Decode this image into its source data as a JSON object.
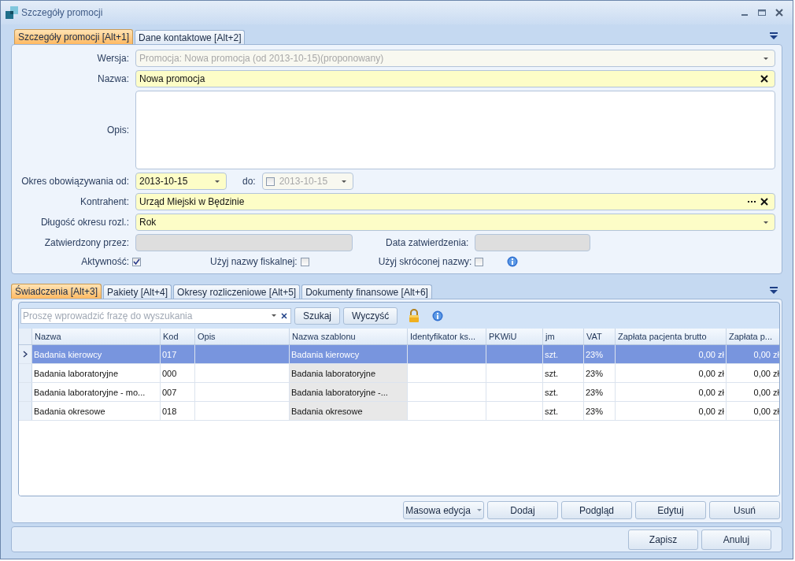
{
  "window": {
    "title": "Szczegóły promocji"
  },
  "top_tabs": [
    {
      "label": "Szczegóły promocji [Alt+1]",
      "selected": true
    },
    {
      "label": "Dane kontaktowe [Alt+2]",
      "selected": false
    }
  ],
  "form": {
    "version": {
      "label": "Wersja:",
      "value": "Promocja: Nowa promocja (od 2013-10-15)(proponowany)",
      "disabled": true
    },
    "name": {
      "label": "Nazwa:",
      "value": "Nowa promocja"
    },
    "description": {
      "label": "Opis:"
    },
    "period_from": {
      "label": "Okres obowiązywania od:",
      "value": "2013-10-15"
    },
    "period_to": {
      "label": "do:",
      "value": "2013-10-15",
      "checked": false,
      "disabled": true
    },
    "contractor": {
      "label": "Kontrahent:",
      "value": "Urząd Miejski w Będzinie"
    },
    "settlement_length": {
      "label": "Długość okresu rozl.:",
      "value": "Rok"
    },
    "approved_by": {
      "label": "Zatwierdzony przez:"
    },
    "approval_date": {
      "label": "Data zatwierdzenia:"
    },
    "checkboxes": [
      {
        "label": "Aktywność:",
        "checked": true
      },
      {
        "label": "Użyj nazwy fiskalnej:",
        "checked": false
      },
      {
        "label": "Użyj skróconej nazwy:",
        "checked": false
      }
    ]
  },
  "bottom_tabs": [
    {
      "label": "Świadczenia [Alt+3]",
      "selected": true
    },
    {
      "label": "Pakiety [Alt+4]",
      "selected": false
    },
    {
      "label": "Okresy rozliczeniowe [Alt+5]",
      "selected": false
    },
    {
      "label": "Dokumenty finansowe [Alt+6]",
      "selected": false
    }
  ],
  "search": {
    "placeholder": "Proszę wprowadzić frazę do wyszukania",
    "buttons": [
      "Szukaj",
      "Wyczyść"
    ]
  },
  "table": {
    "columns": [
      {
        "label": "Nazwa",
        "kind": "text",
        "shaded": false
      },
      {
        "label": "Kod",
        "kind": "text",
        "shaded": false
      },
      {
        "label": "Opis",
        "kind": "text",
        "shaded": false
      },
      {
        "label": "Nazwa szablonu",
        "kind": "text",
        "shaded": true
      },
      {
        "label": "Identyfikator ks...",
        "kind": "text",
        "shaded": false
      },
      {
        "label": "PKWiU",
        "kind": "text",
        "shaded": false
      },
      {
        "label": "jm",
        "kind": "text",
        "shaded": false
      },
      {
        "label": "VAT",
        "kind": "text",
        "shaded": false
      },
      {
        "label": "Zapłata pacjenta brutto",
        "kind": "money",
        "shaded": false
      },
      {
        "label": "Zapłata p...",
        "kind": "money",
        "shaded": false
      }
    ],
    "rows": [
      {
        "selected": true,
        "cells": [
          "Badania kierowcy",
          "017",
          "",
          "Badania kierowcy",
          "",
          "",
          "szt.",
          "23%",
          "0,00 zł",
          "0,00 zł"
        ]
      },
      {
        "selected": false,
        "cells": [
          "Badania laboratoryjne",
          "000",
          "",
          "Badania laboratoryjne",
          "",
          "",
          "szt.",
          "23%",
          "0,00 zł",
          "0,00 zł"
        ]
      },
      {
        "selected": false,
        "cells": [
          "Badania laboratoryjne - mo...",
          "007",
          "",
          "Badania laboratoryjne -...",
          "",
          "",
          "szt.",
          "23%",
          "0,00 zł",
          "0,00 zł"
        ]
      },
      {
        "selected": false,
        "cells": [
          "Badania okresowe",
          "018",
          "",
          "Badania okresowe",
          "",
          "",
          "szt.",
          "23%",
          "0,00 zł",
          "0,00 zł"
        ]
      }
    ]
  },
  "action_buttons": [
    {
      "label": "Masowa edycja",
      "kind": "dropdown"
    },
    {
      "label": "Dodaj",
      "kind": "plain"
    },
    {
      "label": "Podgląd",
      "kind": "plain"
    },
    {
      "label": "Edytuj",
      "kind": "plain"
    },
    {
      "label": "Usuń",
      "kind": "plain"
    }
  ],
  "dialog_buttons": [
    "Zapisz",
    "Anuluj"
  ]
}
